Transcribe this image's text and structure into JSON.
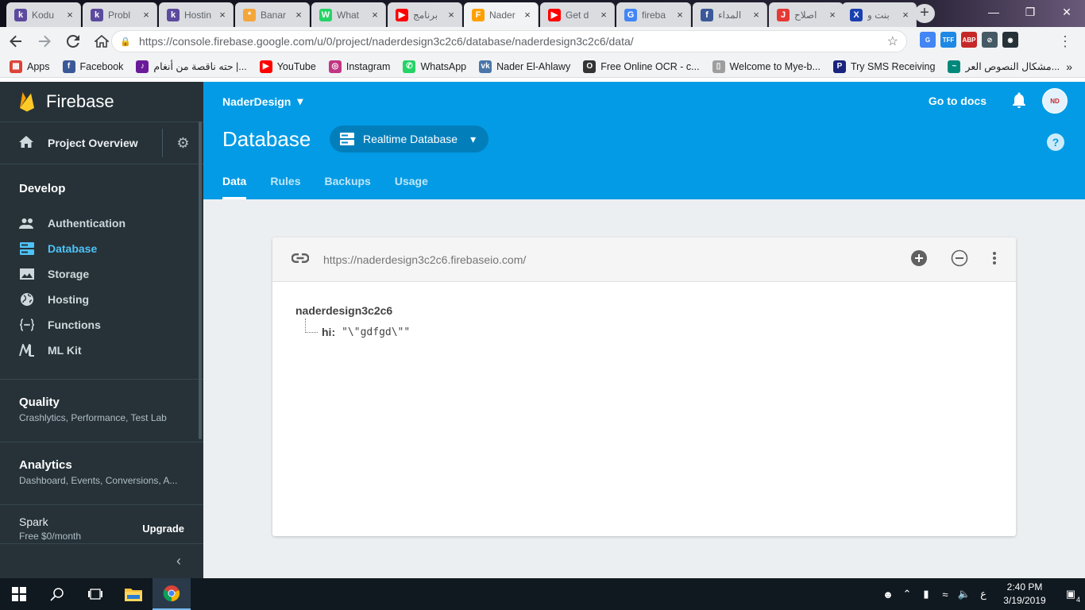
{
  "browser": {
    "tabs": [
      {
        "title": "Kodu",
        "icon": "k",
        "color": "#5c4a9e"
      },
      {
        "title": "Probl",
        "icon": "k",
        "color": "#5c4a9e"
      },
      {
        "title": "Hostin",
        "icon": "k",
        "color": "#5c4a9e"
      },
      {
        "title": "Banar",
        "icon": "*",
        "color": "#f4a63b"
      },
      {
        "title": "What",
        "icon": "W",
        "color": "#25d366"
      },
      {
        "title": "برنامج",
        "icon": "▶",
        "color": "#ff0000"
      },
      {
        "title": "Nader",
        "icon": "F",
        "color": "#ffa000"
      },
      {
        "title": "Get d",
        "icon": "▶",
        "color": "#ff0000"
      },
      {
        "title": "fireba",
        "icon": "G",
        "color": "#4285f4"
      },
      {
        "title": "المداء",
        "icon": "f",
        "color": "#3b5998"
      },
      {
        "title": "اصلاح",
        "icon": "J",
        "color": "#e53935"
      },
      {
        "title": "بنت و",
        "icon": "X",
        "color": "#1a3fb0"
      }
    ],
    "active_tab_index": 6,
    "url": "https://console.firebase.google.com/u/0/project/naderdesign3c2c6/database/naderdesign3c2c6/data/",
    "bookmarks": [
      {
        "label": "Apps",
        "icon": "▦",
        "color": "#db4437"
      },
      {
        "label": "Facebook",
        "icon": "f",
        "color": "#3b5998"
      },
      {
        "label": "حته ناقصة من أنغام |...",
        "icon": "♪",
        "color": "#6a1b9a"
      },
      {
        "label": "YouTube",
        "icon": "▶",
        "color": "#ff0000"
      },
      {
        "label": "Instagram",
        "icon": "◎",
        "color": "#c13584"
      },
      {
        "label": "WhatsApp",
        "icon": "✆",
        "color": "#25d366"
      },
      {
        "label": "Nader El-Ahlawy",
        "icon": "vk",
        "color": "#4a76a8"
      },
      {
        "label": "Free Online OCR - c...",
        "icon": "O",
        "color": "#333333"
      },
      {
        "label": "Welcome to Mye-b...",
        "icon": "▯",
        "color": "#9e9e9e"
      },
      {
        "label": "Try SMS Receiving",
        "icon": "P",
        "color": "#1a237e"
      },
      {
        "label": "مشكال النصوص العر...",
        "icon": "~",
        "color": "#00897b"
      }
    ]
  },
  "sidebar": {
    "brand": "Firebase",
    "project_overview": "Project Overview",
    "develop_title": "Develop",
    "items": [
      {
        "label": "Authentication",
        "icon": "people-icon"
      },
      {
        "label": "Database",
        "icon": "database-icon"
      },
      {
        "label": "Storage",
        "icon": "image-icon"
      },
      {
        "label": "Hosting",
        "icon": "globe-icon"
      },
      {
        "label": "Functions",
        "icon": "functions-icon"
      },
      {
        "label": "ML Kit",
        "icon": "mlkit-icon"
      }
    ],
    "quality": {
      "title": "Quality",
      "subtitle": "Crashlytics, Performance, Test Lab"
    },
    "analytics": {
      "title": "Analytics",
      "subtitle": "Dashboard, Events, Conversions, A..."
    },
    "plan": {
      "name": "Spark",
      "price": "Free $0/month",
      "upgrade": "Upgrade"
    }
  },
  "header": {
    "project": "NaderDesign",
    "docs": "Go to docs",
    "title": "Database",
    "db_selector": "Realtime Database",
    "tabs": [
      "Data",
      "Rules",
      "Backups",
      "Usage"
    ],
    "active_tab": "Data"
  },
  "database": {
    "url": "https://naderdesign3c2c6.firebaseio.com/",
    "root": "naderdesign3c2c6",
    "children": [
      {
        "key": "hi:",
        "value": "\"\\\"gdfgd\\\"\""
      }
    ]
  },
  "taskbar": {
    "time": "2:40 PM",
    "date": "3/19/2019",
    "notifications": "4",
    "lang": "ع"
  },
  "colors": {
    "firebase_header": "#039be5",
    "sidebar": "#263238",
    "active_nav": "#4fc3f7"
  }
}
